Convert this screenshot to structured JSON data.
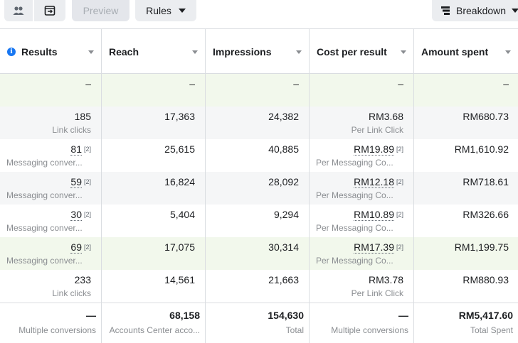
{
  "toolbar": {
    "preview_label": "Preview",
    "rules_label": "Rules",
    "breakdown_label": "Breakdown"
  },
  "table": {
    "columns": [
      "Results",
      "Reach",
      "Impressions",
      "Cost per result",
      "Amount spent"
    ],
    "colors": {
      "highlight_row": "#f2f8ec",
      "alt_row": "#f5f6f7",
      "border": "#dadde1",
      "info_icon": "#1877f2"
    },
    "rows": [
      {
        "results": "–",
        "results_sub": "",
        "reach": "–",
        "reach_sub": "",
        "impressions": "–",
        "cost": "–",
        "cost_sub": "",
        "amount": "–"
      },
      {
        "results": "185",
        "results_sub": "Link clicks",
        "reach": "17,363",
        "impressions": "24,382",
        "cost": "RM3.68",
        "cost_sub": "Per Link Click",
        "amount": "RM680.73"
      },
      {
        "results": "81",
        "results_sup": "[2]",
        "results_sub": "Messaging conver...",
        "reach": "25,615",
        "impressions": "40,885",
        "cost": "RM19.89",
        "cost_sup": "[2]",
        "cost_sub": "Per Messaging Co...",
        "amount": "RM1,610.92"
      },
      {
        "results": "59",
        "results_sup": "[2]",
        "results_sub": "Messaging conver...",
        "reach": "16,824",
        "impressions": "28,092",
        "cost": "RM12.18",
        "cost_sup": "[2]",
        "cost_sub": "Per Messaging Co...",
        "amount": "RM718.61"
      },
      {
        "results": "30",
        "results_sup": "[2]",
        "results_sub": "Messaging conver...",
        "reach": "5,404",
        "impressions": "9,294",
        "cost": "RM10.89",
        "cost_sup": "[2]",
        "cost_sub": "Per Messaging Co...",
        "amount": "RM326.66"
      },
      {
        "results": "69",
        "results_sup": "[2]",
        "results_sub": "Messaging conver...",
        "reach": "17,075",
        "impressions": "30,314",
        "cost": "RM17.39",
        "cost_sup": "[2]",
        "cost_sub": "Per Messaging Co...",
        "amount": "RM1,199.75"
      },
      {
        "results": "233",
        "results_sub": "Link clicks",
        "reach": "14,561",
        "impressions": "21,663",
        "cost": "RM3.78",
        "cost_sub": "Per Link Click",
        "amount": "RM880.93"
      }
    ],
    "totals": {
      "results": "—",
      "results_sub": "Multiple conversions",
      "reach": "68,158",
      "reach_sub": "Accounts Center acco...",
      "impressions": "154,630",
      "impressions_sub": "Total",
      "cost": "—",
      "cost_sub": "Multiple conversions",
      "amount": "RM5,417.60",
      "amount_sub": "Total Spent"
    }
  }
}
